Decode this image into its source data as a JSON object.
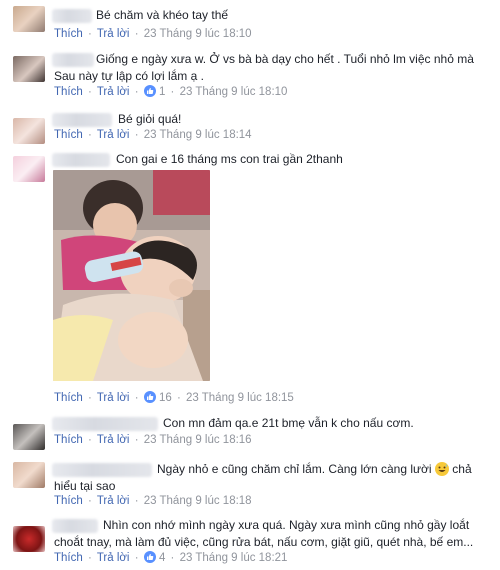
{
  "actions": {
    "like": "Thích",
    "reply": "Trả lời",
    "sep": "·"
  },
  "comments": [
    {
      "text": "Bé chăm và khéo tay thế",
      "time": "23 Tháng 9 lúc 18:10"
    },
    {
      "line1": "Giống e ngày xưa w. Ở vs bà bà dạy cho hết . Tuổi nhỏ lm việc nhỏ mà",
      "line2": "Sau này tự lập có lợi lắm ạ .",
      "likes": "1",
      "time": "23 Tháng 9 lúc 18:10"
    },
    {
      "text": "Bé giỏi quá!",
      "time": "23 Tháng 9 lúc 18:14"
    },
    {
      "text": "Con gai e 16 tháng ms con trai gần 2thanh",
      "likes": "16",
      "time": "23 Tháng 9 lúc 18:15"
    },
    {
      "text": "Con mn đảm qa.e 21t bmẹ vẫn k cho nấu cơm.",
      "time": "23 Tháng 9 lúc 18:16"
    },
    {
      "line1": "Ngày nhỏ e cũng chăm chỉ lắm. Càng lớn càng lười",
      "line1b": "chả",
      "line2": "hiểu tại sao",
      "emoji": "grinning-sweat-emoji",
      "time": "23 Tháng 9 lúc 18:18"
    },
    {
      "line1": "Nhìn con nhớ mình ngày xưa quá. Ngày xưa mình cũng nhỏ gầy loắt",
      "line2": "choắt tnay, mà làm đủ việc, cũng rửa bát, nấu cơm, giặt giũ, quét nhà, bế em...",
      "likes": "4",
      "time": "23 Tháng 9 lúc 18:21"
    }
  ],
  "colors": {
    "link": "#4267b2",
    "meta": "#90949c",
    "like_badge": "#5890ff"
  }
}
